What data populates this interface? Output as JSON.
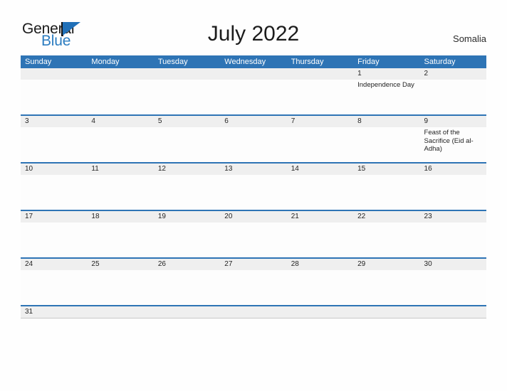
{
  "brand": {
    "word_one": "General",
    "word_two": "Blue",
    "triangle_icon": "triangle-logo-icon",
    "color_blue": "#2070b8",
    "color_text": "#1a1a1a"
  },
  "header": {
    "title": "July 2022",
    "country": "Somalia",
    "accent_color": "#2e74b5"
  },
  "calendar": {
    "weekday_headers": [
      "Sunday",
      "Monday",
      "Tuesday",
      "Wednesday",
      "Thursday",
      "Friday",
      "Saturday"
    ],
    "weeks": [
      {
        "dates": [
          "",
          "",
          "",
          "",
          "",
          "1",
          "2"
        ],
        "events": [
          "",
          "",
          "",
          "",
          "",
          "Independence Day",
          ""
        ]
      },
      {
        "dates": [
          "3",
          "4",
          "5",
          "6",
          "7",
          "8",
          "9"
        ],
        "events": [
          "",
          "",
          "",
          "",
          "",
          "",
          "Feast of the Sacrifice (Eid al-Adha)"
        ]
      },
      {
        "dates": [
          "10",
          "11",
          "12",
          "13",
          "14",
          "15",
          "16"
        ],
        "events": [
          "",
          "",
          "",
          "",
          "",
          "",
          ""
        ]
      },
      {
        "dates": [
          "17",
          "18",
          "19",
          "20",
          "21",
          "22",
          "23"
        ],
        "events": [
          "",
          "",
          "",
          "",
          "",
          "",
          ""
        ]
      },
      {
        "dates": [
          "24",
          "25",
          "26",
          "27",
          "28",
          "29",
          "30"
        ],
        "events": [
          "",
          "",
          "",
          "",
          "",
          "",
          ""
        ]
      },
      {
        "dates": [
          "31",
          "",
          "",
          "",
          "",
          "",
          ""
        ],
        "events": [
          "",
          "",
          "",
          "",
          "",
          "",
          ""
        ]
      }
    ]
  }
}
